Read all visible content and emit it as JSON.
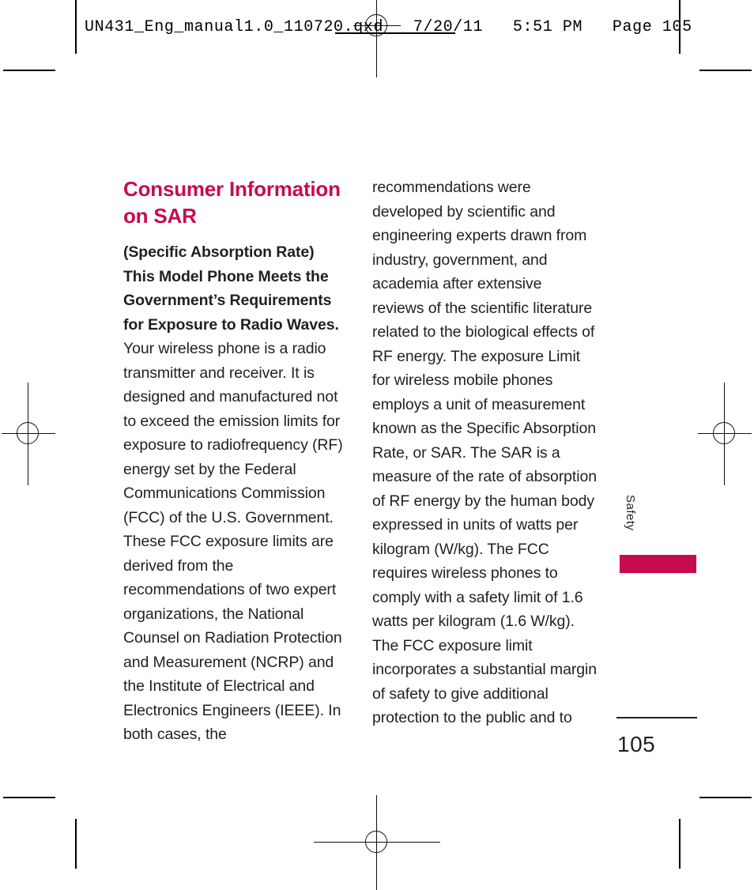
{
  "document": {
    "slug_line": "UN431_Eng_manual1.0_110720.qxd   7/20/11   5:51 PM   Page 105",
    "page_number": "105",
    "side_tab_label": "Safety",
    "accent_color": "#C80A50",
    "text_color": "#231f20"
  },
  "content": {
    "title": "Consumer Information on SAR",
    "left_column": {
      "lead_bold": "(Specific Absorption Rate) This Model Phone Meets the Government’s Requirements for Exposure to Radio Waves.",
      "body": " Your wireless phone is a radio transmitter and receiver. It is designed and manufactured not to exceed the emission limits for exposure to radiofrequency (RF) energy set by the Federal Communications Commission (FCC) of the U.S. Government. These FCC exposure limits are derived from the recommendations of two expert organizations, the National Counsel on Radiation Protection and Measurement (NCRP) and the Institute of Electrical and Electronics Engineers (IEEE). In both cases, the"
    },
    "right_column": {
      "body": "recommendations were developed by scientific and engineering experts drawn from industry, government, and academia after extensive reviews of the scientific literature related to the biological effects of RF energy. The exposure Limit for wireless mobile phones employs a unit of measurement known as the Specific Absorption Rate, or SAR. The SAR is a measure of the rate of absorption of RF energy by the human body expressed in units of watts per kilogram (W/kg). The FCC requires wireless phones to comply with a safety limit of 1.6 watts per kilogram (1.6 W/kg). The FCC exposure limit incorporates a substantial margin of safety to give additional protection to the public and to"
    }
  },
  "marks": {
    "registration_top": "registration-mark",
    "registration_bottom": "registration-mark",
    "registration_left": "registration-mark",
    "registration_right": "registration-mark",
    "crop_marks": "crop-marks"
  }
}
